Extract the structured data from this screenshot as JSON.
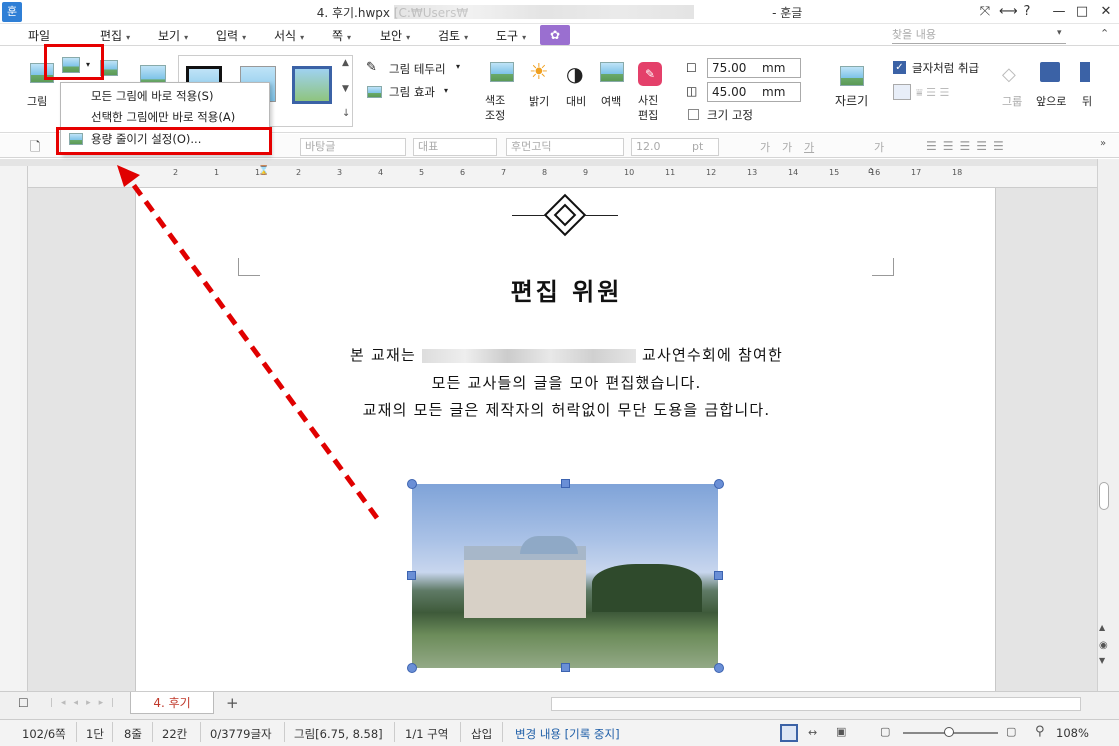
{
  "app": {
    "icon_text": "훈",
    "title": "4. 후기.hwpx [C:₩Users₩",
    "title_suffix": " - 훈글",
    "window_buttons": [
      "⤧",
      "⟷",
      "?",
      "—",
      "□",
      "✕"
    ]
  },
  "menu": {
    "items": [
      "파일",
      "편집",
      "보기",
      "입력",
      "서식",
      "쪽",
      "보안",
      "검토",
      "도구"
    ],
    "find_placeholder": "찾을 내용"
  },
  "ribbon": {
    "picture_label": "그림",
    "border_label": "그림 테두리",
    "effect_label": "그림 효과",
    "color_label": "색조\n조정",
    "brightness_label": "밝기",
    "contrast_label": "대비",
    "margin_label": "여백",
    "photo_edit_label": "사진\n편집",
    "width_value": "75.00",
    "height_value": "45.00",
    "unit": "mm",
    "lock_size_label": "크기 고정",
    "crop_label": "자르기",
    "wrap_label": "글자처럼 취급",
    "group_label": "그룹",
    "front_label": "앞으로",
    "back_label": "뒤"
  },
  "toolbar2": {
    "style": "바탕글",
    "para": "대표",
    "font": "후먼고딕",
    "size": "12.0",
    "size_unit": "pt",
    "fmt": [
      "가",
      "가",
      "가",
      "가"
    ]
  },
  "dropdown": {
    "items": [
      "모든 그림에 바로 적용(S)",
      "선택한 그림에만 바로 적용(A)",
      "용량 줄이기 설정(O)..."
    ]
  },
  "document": {
    "heading": "편집 위원",
    "line1_prefix": "본 교재는",
    "line1_suffix": "교사연수회에 참여한",
    "line2": "모든 교사들의 글을 모아 편집했습니다.",
    "line3": "교재의 모든 글은 제작자의 허락없이 무단 도용을 금합니다."
  },
  "ruler": {
    "h_ticks": [
      "2",
      "1",
      "1",
      "2",
      "3",
      "4",
      "5",
      "6",
      "7",
      "8",
      "9",
      "10",
      "11",
      "12",
      "13",
      "14",
      "15",
      "16",
      "17",
      "18"
    ]
  },
  "tabs": {
    "active": "4. 후기",
    "add": "+"
  },
  "status": {
    "page": "102/6쪽",
    "col": "1단",
    "line": "8줄",
    "cell": "22칸",
    "chars": "0/3779글자",
    "pic": "그림[6.75, 8.58]",
    "section": "1/1 구역",
    "mode": "삽입",
    "track": "변경 내용 [기록 중지]",
    "zoom": "108%"
  },
  "colors": {
    "accent": "#2f7fd6",
    "highlight": "#e60000",
    "menu_purple": "#9a6fd0"
  }
}
